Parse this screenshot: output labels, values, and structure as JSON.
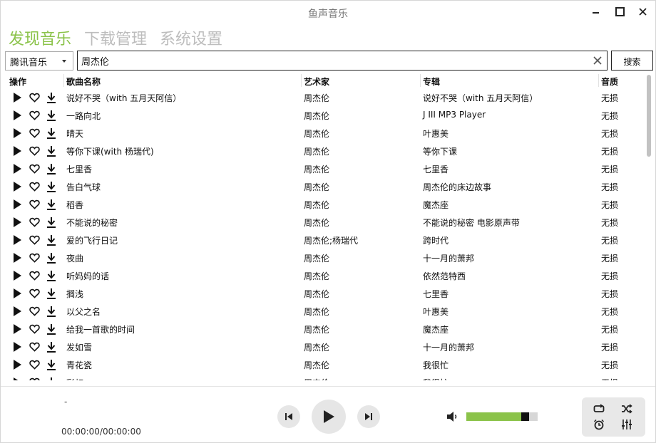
{
  "app": {
    "title": "鱼声音乐"
  },
  "tabs": [
    {
      "label": "发现音乐",
      "active": true
    },
    {
      "label": "下载管理",
      "active": false
    },
    {
      "label": "系统设置",
      "active": false
    }
  ],
  "search": {
    "source": "腾讯音乐",
    "query": "周杰伦",
    "button_label": "搜索"
  },
  "table": {
    "columns": {
      "ops": "操作",
      "name": "歌曲名称",
      "artist": "艺术家",
      "album": "专辑",
      "quality": "音质"
    },
    "rows": [
      {
        "name": "说好不哭（with 五月天阿信）",
        "artist": "周杰伦",
        "album": "说好不哭（with 五月天阿信）",
        "quality": "无损"
      },
      {
        "name": "一路向北",
        "artist": "周杰伦",
        "album": "J III MP3 Player",
        "quality": "无损"
      },
      {
        "name": "晴天",
        "artist": "周杰伦",
        "album": "叶惠美",
        "quality": "无损"
      },
      {
        "name": "等你下课(with 杨瑞代)",
        "artist": "周杰伦",
        "album": "等你下课",
        "quality": "无损"
      },
      {
        "name": "七里香",
        "artist": "周杰伦",
        "album": "七里香",
        "quality": "无损"
      },
      {
        "name": "告白气球",
        "artist": "周杰伦",
        "album": "周杰伦的床边故事",
        "quality": "无损"
      },
      {
        "name": "稻香",
        "artist": "周杰伦",
        "album": "魔杰座",
        "quality": "无损"
      },
      {
        "name": "不能说的秘密",
        "artist": "周杰伦",
        "album": "不能说的秘密 电影原声带",
        "quality": "无损"
      },
      {
        "name": "爱的飞行日记",
        "artist": "周杰伦;杨瑞代",
        "album": "跨时代",
        "quality": "无损"
      },
      {
        "name": "夜曲",
        "artist": "周杰伦",
        "album": "十一月的萧邦",
        "quality": "无损"
      },
      {
        "name": "听妈妈的话",
        "artist": "周杰伦",
        "album": "依然范特西",
        "quality": "无损"
      },
      {
        "name": "搁浅",
        "artist": "周杰伦",
        "album": "七里香",
        "quality": "无损"
      },
      {
        "name": "以父之名",
        "artist": "周杰伦",
        "album": "叶惠美",
        "quality": "无损"
      },
      {
        "name": "给我一首歌的时间",
        "artist": "周杰伦",
        "album": "魔杰座",
        "quality": "无损"
      },
      {
        "name": "发如雪",
        "artist": "周杰伦",
        "album": "十一月的萧邦",
        "quality": "无损"
      },
      {
        "name": "青花瓷",
        "artist": "周杰伦",
        "album": "我很忙",
        "quality": "无损"
      },
      {
        "name": "彩虹",
        "artist": "周杰伦",
        "album": "我很忙",
        "quality": "无损"
      }
    ]
  },
  "player": {
    "title": "-",
    "time": "00:00:00/00:00:00",
    "volume_fraction": 0.85
  },
  "icons": {
    "play": "play-icon",
    "like": "heart-icon",
    "download": "download-icon",
    "prev": "skip-previous-icon",
    "next": "skip-next-icon",
    "volume": "volume-icon",
    "repeat": "repeat-icon",
    "shuffle": "shuffle-icon",
    "timer": "alarm-clock-icon",
    "equalizer": "equalizer-icon"
  },
  "colors": {
    "accent": "#8bc34a",
    "inactive_tab": "#bdbdbd",
    "panel": "#e8e8e8"
  }
}
